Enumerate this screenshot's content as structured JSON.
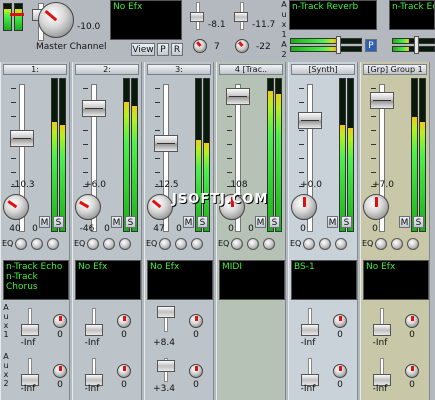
{
  "master": {
    "label": "Master Channel",
    "volume": "-10.0",
    "efx": "No Efx",
    "view": "View",
    "p": "P",
    "r": "R",
    "val1": "-8.1",
    "val2": "-11.7",
    "val3": "7",
    "val4": "-22"
  },
  "aux_send": {
    "name1": "n-Track Reverb",
    "name2": "n-Track Ec",
    "labels": [
      "A",
      "u",
      "x",
      "1",
      "A",
      "u",
      "x",
      "2"
    ],
    "p": "P"
  },
  "channels": [
    {
      "id": "ch1",
      "header": "1:",
      "volume": "-10.3",
      "pan_left": "40",
      "pan_right": "0",
      "m": "M",
      "s": "S",
      "eq": "EQ",
      "efx": [
        "n-Track Echo",
        "n-Track Chorus"
      ],
      "aux1": "-Inf",
      "aux1k": "0",
      "aux2": "-Inf",
      "aux2k": "0"
    },
    {
      "id": "ch2",
      "header": "2:",
      "volume": "+6.0",
      "pan_left": "-46",
      "pan_right": "0",
      "m": "M",
      "s": "S",
      "eq": "EQ",
      "efx": [
        "No Efx",
        ""
      ],
      "aux1": "-Inf",
      "aux1k": "0",
      "aux2": "-Inf",
      "aux2k": "0"
    },
    {
      "id": "ch3",
      "header": "3:",
      "volume": "-12.5",
      "pan_left": "47",
      "pan_right": "0",
      "m": "M",
      "s": "S",
      "eq": "EQ",
      "efx": [
        "No Efx",
        ""
      ],
      "aux1": "+8.4",
      "aux1k": "0",
      "aux2": "+3.4",
      "aux2k": "0"
    },
    {
      "id": "ch4",
      "header": "4 [Trac..",
      "volume": "108",
      "pan_left": "0",
      "pan_right": "0",
      "m": "M",
      "s": "S",
      "eq": "EQ",
      "efx": [
        "MIDI",
        ""
      ],
      "aux1": "",
      "aux1k": "",
      "aux2": "",
      "aux2k": ""
    },
    {
      "id": "ch5",
      "header": "[Synth]",
      "volume": "+0.0",
      "pan_left": "0",
      "pan_right": "",
      "m": "M",
      "s": "S",
      "eq": "EQ",
      "efx": [
        "BS-1",
        ""
      ],
      "aux1": "-Inf",
      "aux1k": "0",
      "aux2": "-Inf",
      "aux2k": "0"
    },
    {
      "id": "ch6",
      "header": "[Grp] Group 1",
      "volume": "+7.0",
      "pan_left": "0",
      "pan_right": "",
      "m": "M",
      "s": "S",
      "eq": "EQ",
      "efx": [
        "No Efx",
        ""
      ],
      "aux1": "-Inf",
      "aux1k": "0",
      "aux2": "-Inf",
      "aux2k": "0"
    }
  ],
  "aux_labels": [
    "A",
    "u",
    "x",
    "1",
    "A",
    "u",
    "x",
    "2"
  ],
  "watermark": "JSOFTJ.COM",
  "colors": {
    "lcd_text": "#3df03d",
    "meter": "#4ef04e",
    "knob_mark": "#e01010",
    "midi_strip": "#b7c2b7",
    "synth_strip": "#c8d2d8",
    "group_strip": "#c8c8a8"
  }
}
